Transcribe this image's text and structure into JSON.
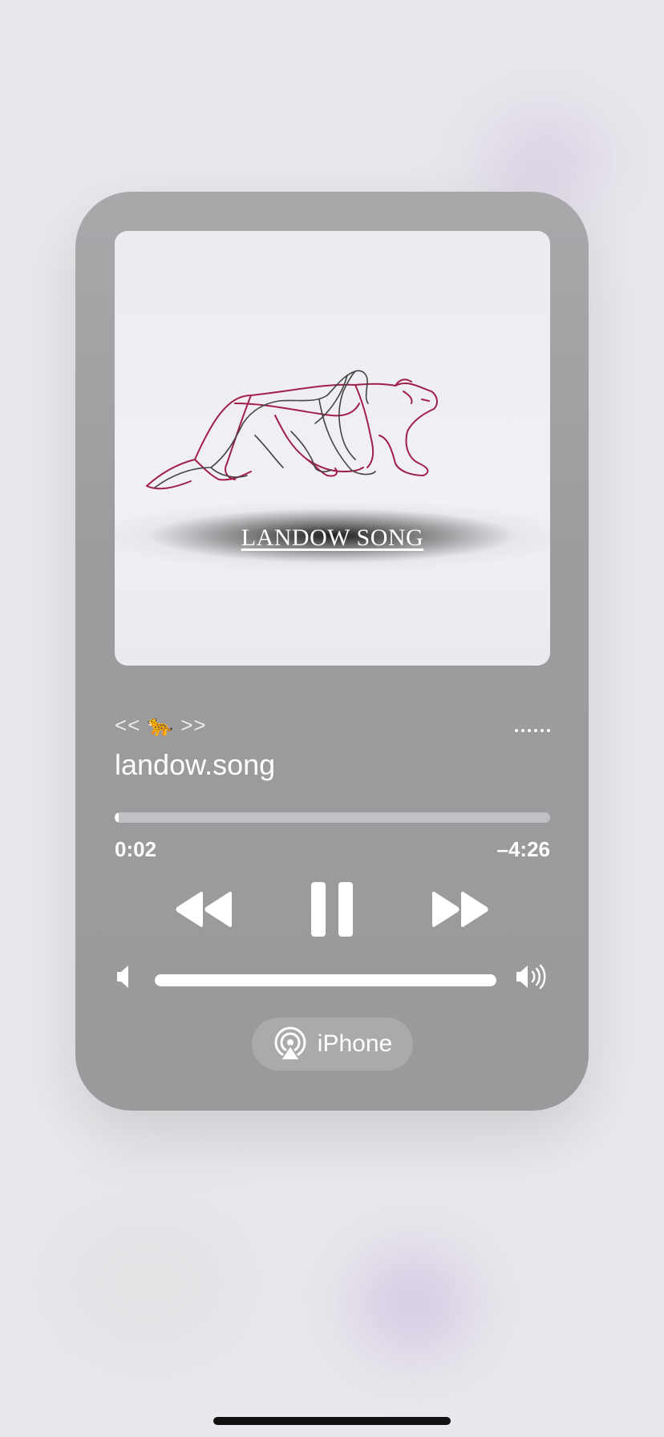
{
  "now_playing": {
    "artwork_title": "LANDOW SONG",
    "subtitle": "<< 🐆 >>",
    "song_title": "landow.song",
    "progress_fraction": 0.01,
    "elapsed": "0:02",
    "remaining": "–4:26",
    "state": "playing",
    "volume_fraction": 1.0,
    "output_device": "iPhone"
  },
  "icons": {
    "previous": "backward-icon",
    "pause": "pause-icon",
    "next": "forward-icon",
    "volume_low": "speaker-low-icon",
    "volume_high": "speaker-high-icon",
    "airplay": "airplay-icon",
    "more": "more-dots-icon"
  },
  "colors": {
    "card": "#9c9c9e",
    "text": "#ffffff",
    "art_line_red": "#a0204a",
    "art_line_dark": "#444444"
  }
}
